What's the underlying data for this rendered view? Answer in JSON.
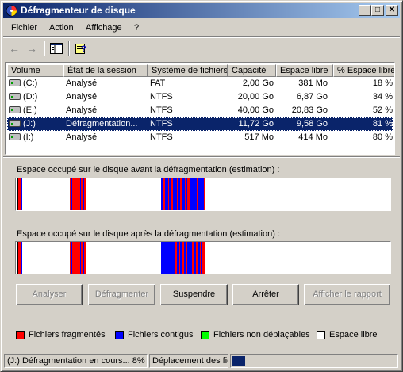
{
  "window": {
    "title": "Défragmenteur de disque"
  },
  "menu": {
    "file": "Fichier",
    "action": "Action",
    "view": "Affichage",
    "help": "?"
  },
  "columns": [
    "Volume",
    "État de la session",
    "Système de fichiers",
    "Capacité",
    "Espace libre",
    "% Espace libre"
  ],
  "volumes": [
    {
      "volume": "(C:)",
      "state": "Analysé",
      "fs": "FAT",
      "capacity": "2,00 Go",
      "free": "381 Mo",
      "pct": "18 %",
      "selected": false
    },
    {
      "volume": "(D:)",
      "state": "Analysé",
      "fs": "NTFS",
      "capacity": "20,00 Go",
      "free": "6,87 Go",
      "pct": "34 %",
      "selected": false
    },
    {
      "volume": "(E:)",
      "state": "Analysé",
      "fs": "NTFS",
      "capacity": "40,00 Go",
      "free": "20,83 Go",
      "pct": "52 %",
      "selected": false
    },
    {
      "volume": "(J:)",
      "state": "Défragmentation...",
      "fs": "NTFS",
      "capacity": "11,72 Go",
      "free": "9,58 Go",
      "pct": "81 %",
      "selected": true
    },
    {
      "volume": "(I:)",
      "state": "Analysé",
      "fs": "NTFS",
      "capacity": "517 Mo",
      "free": "414 Mo",
      "pct": "80 %",
      "selected": false
    }
  ],
  "maps": {
    "before_label": "Espace occupé sur le disque avant la défragmentation (estimation) :",
    "after_label": "Espace occupé sur le disque après la défragmentation (estimation) :"
  },
  "buttons": {
    "analyze": "Analyser",
    "defrag": "Défragmenter",
    "pause": "Suspendre",
    "stop": "Arrêter",
    "report": "Afficher le rapport"
  },
  "legend": {
    "fragmented": "Fichiers fragmentés",
    "contiguous": "Fichiers contigus",
    "unmovable": "Fichiers non déplaçables",
    "free": "Espace libre"
  },
  "colors": {
    "fragmented": "#ff0000",
    "contiguous": "#0000ff",
    "unmovable": "#00ff00",
    "free": "#ffffff"
  },
  "status": {
    "progress_text": "(J:) Défragmentation en cours... 8%",
    "moving_text": "Déplacement des fic",
    "progress_pct": 8
  }
}
